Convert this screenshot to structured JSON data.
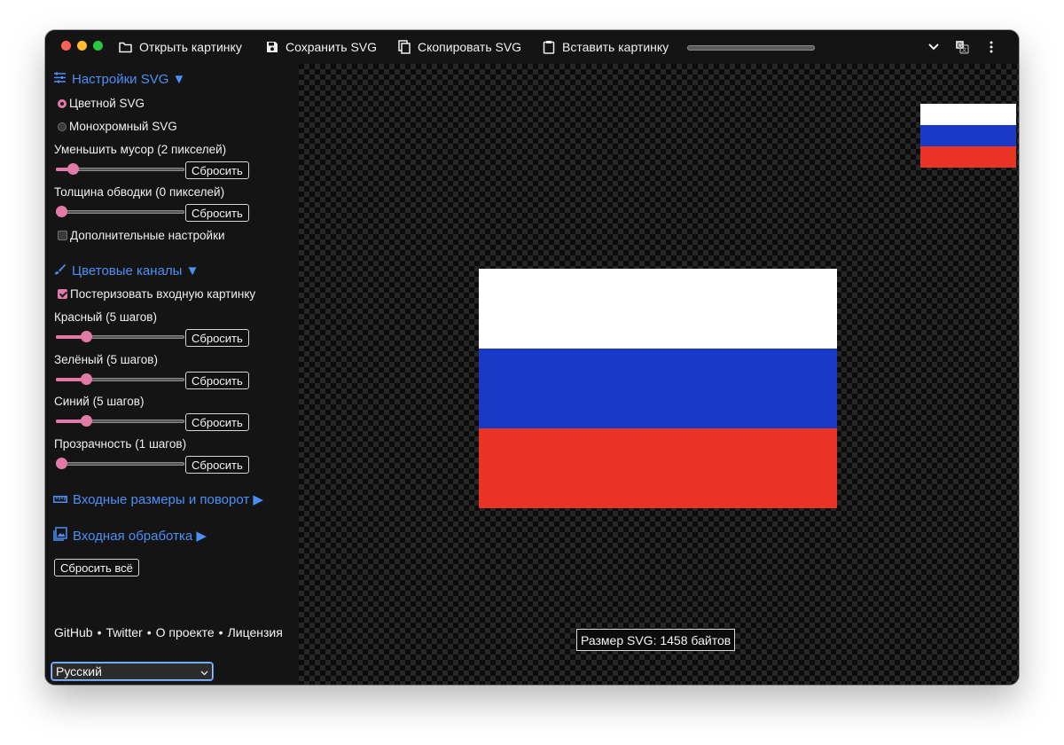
{
  "toolbar": {
    "open_label": "Открыть картинку",
    "save_label": "Сохранить SVG",
    "copy_label": "Скопировать SVG",
    "paste_label": "Вставить картинку",
    "progress": 0
  },
  "settings": {
    "title": "Настройки SVG ▼",
    "color_svg": "Цветной SVG",
    "mono_svg": "Монохромный SVG",
    "reduce_noise": "Уменьшить мусор (2 пикселей)",
    "reduce_noise_value": 2,
    "stroke_width": "Толщина обводки (0 пикселей)",
    "stroke_width_value": 0,
    "advanced": "Дополнительные настройки"
  },
  "channels": {
    "title": "Цветовые каналы ▼",
    "posterize": "Постеризовать входную картинку",
    "red": "Красный (5 шагов)",
    "red_value": 5,
    "green": "Зелёный (5 шагов)",
    "green_value": 5,
    "blue": "Синий (5 шагов)",
    "blue_value": 5,
    "alpha": "Прозрачность (1 шагов)",
    "alpha_value": 1
  },
  "sections": {
    "input_size": "Входные размеры и поворот ▶",
    "input_processing": "Входная обработка ▶"
  },
  "buttons": {
    "reset": "Сбросить",
    "reset_all": "Сбросить всё"
  },
  "links": {
    "github": "GitHub",
    "twitter": "Twitter",
    "about": "О проекте",
    "license": "Лицензия",
    "separator": "•"
  },
  "language": {
    "selected": "Русский"
  },
  "preview": {
    "size_text": "Размер SVG: 1458 байтов",
    "flag_colors": [
      "#ffffff",
      "#1939c6",
      "#e83325"
    ]
  },
  "colors": {
    "accent": "#4d8ff5",
    "control": "#e27aa7",
    "background": "#141414"
  }
}
